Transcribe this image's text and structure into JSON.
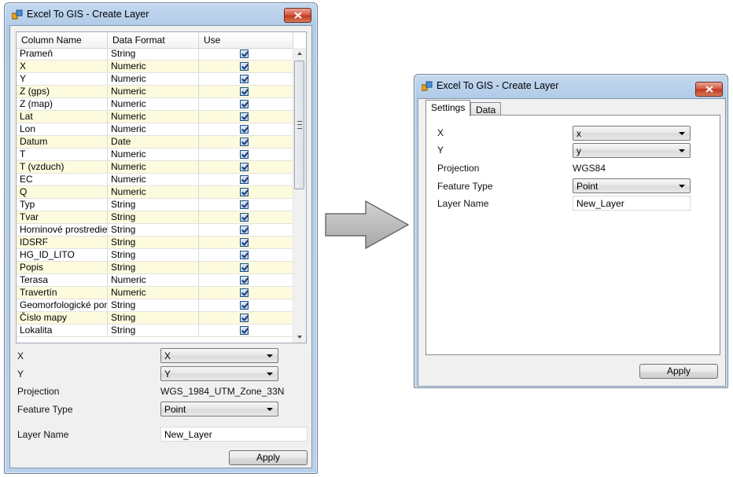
{
  "left_window": {
    "title": "Excel To GIS - Create Layer",
    "columns": [
      "Column Name",
      "Data Format",
      "Use"
    ],
    "rows": [
      {
        "name": "Prameň",
        "format": "String",
        "use": true
      },
      {
        "name": "X",
        "format": "Numeric",
        "use": true
      },
      {
        "name": "Y",
        "format": "Numeric",
        "use": true
      },
      {
        "name": "Z (gps)",
        "format": "Numeric",
        "use": true
      },
      {
        "name": "Z (map)",
        "format": "Numeric",
        "use": true
      },
      {
        "name": " Lat",
        "format": "Numeric",
        "use": true
      },
      {
        "name": " Lon",
        "format": "Numeric",
        "use": true
      },
      {
        "name": " Datum",
        "format": "Date",
        "use": true
      },
      {
        "name": " T",
        "format": "Numeric",
        "use": true
      },
      {
        "name": "T (vzduch)",
        "format": "Numeric",
        "use": true
      },
      {
        "name": "EC",
        "format": "Numeric",
        "use": true
      },
      {
        "name": "Q",
        "format": "Numeric",
        "use": true
      },
      {
        "name": "Typ",
        "format": "String",
        "use": true
      },
      {
        "name": "Tvar",
        "format": "String",
        "use": true
      },
      {
        "name": "Horninové prostredie",
        "format": "String",
        "use": true
      },
      {
        "name": "IDSRF",
        "format": "String",
        "use": true
      },
      {
        "name": "HG_ID_LITO",
        "format": "String",
        "use": true
      },
      {
        "name": "Popis",
        "format": "String",
        "use": true
      },
      {
        "name": "Terasa",
        "format": "Numeric",
        "use": true
      },
      {
        "name": "Travertín",
        "format": "Numeric",
        "use": true
      },
      {
        "name": "Geomorfologické pomery",
        "format": "String",
        "use": true
      },
      {
        "name": "Číslo mapy",
        "format": "String",
        "use": true
      },
      {
        "name": "Lokalita",
        "format": "String",
        "use": true
      }
    ],
    "labels": {
      "x": "X",
      "y": "Y",
      "projection": "Projection",
      "feature_type": "Feature Type",
      "layer_name": "Layer Name"
    },
    "values": {
      "x": "X",
      "y": "Y",
      "projection": "WGS_1984_UTM_Zone_33N",
      "feature_type": "Point",
      "layer_name": "New_Layer"
    },
    "apply_label": "Apply"
  },
  "right_window": {
    "title": "Excel To GIS - Create Layer",
    "tabs": [
      "Settings",
      "Data"
    ],
    "active_tab": "Settings",
    "labels": {
      "x": "X",
      "y": "Y",
      "projection": "Projection",
      "feature_type": "Feature Type",
      "layer_name": "Layer Name"
    },
    "values": {
      "x": "x",
      "y": "y",
      "projection": "WGS84",
      "feature_type": "Point",
      "layer_name": "New_Layer"
    },
    "apply_label": "Apply"
  },
  "icons": {
    "app": "app-icon",
    "close": "close-icon",
    "arrow": "right-arrow-icon"
  }
}
